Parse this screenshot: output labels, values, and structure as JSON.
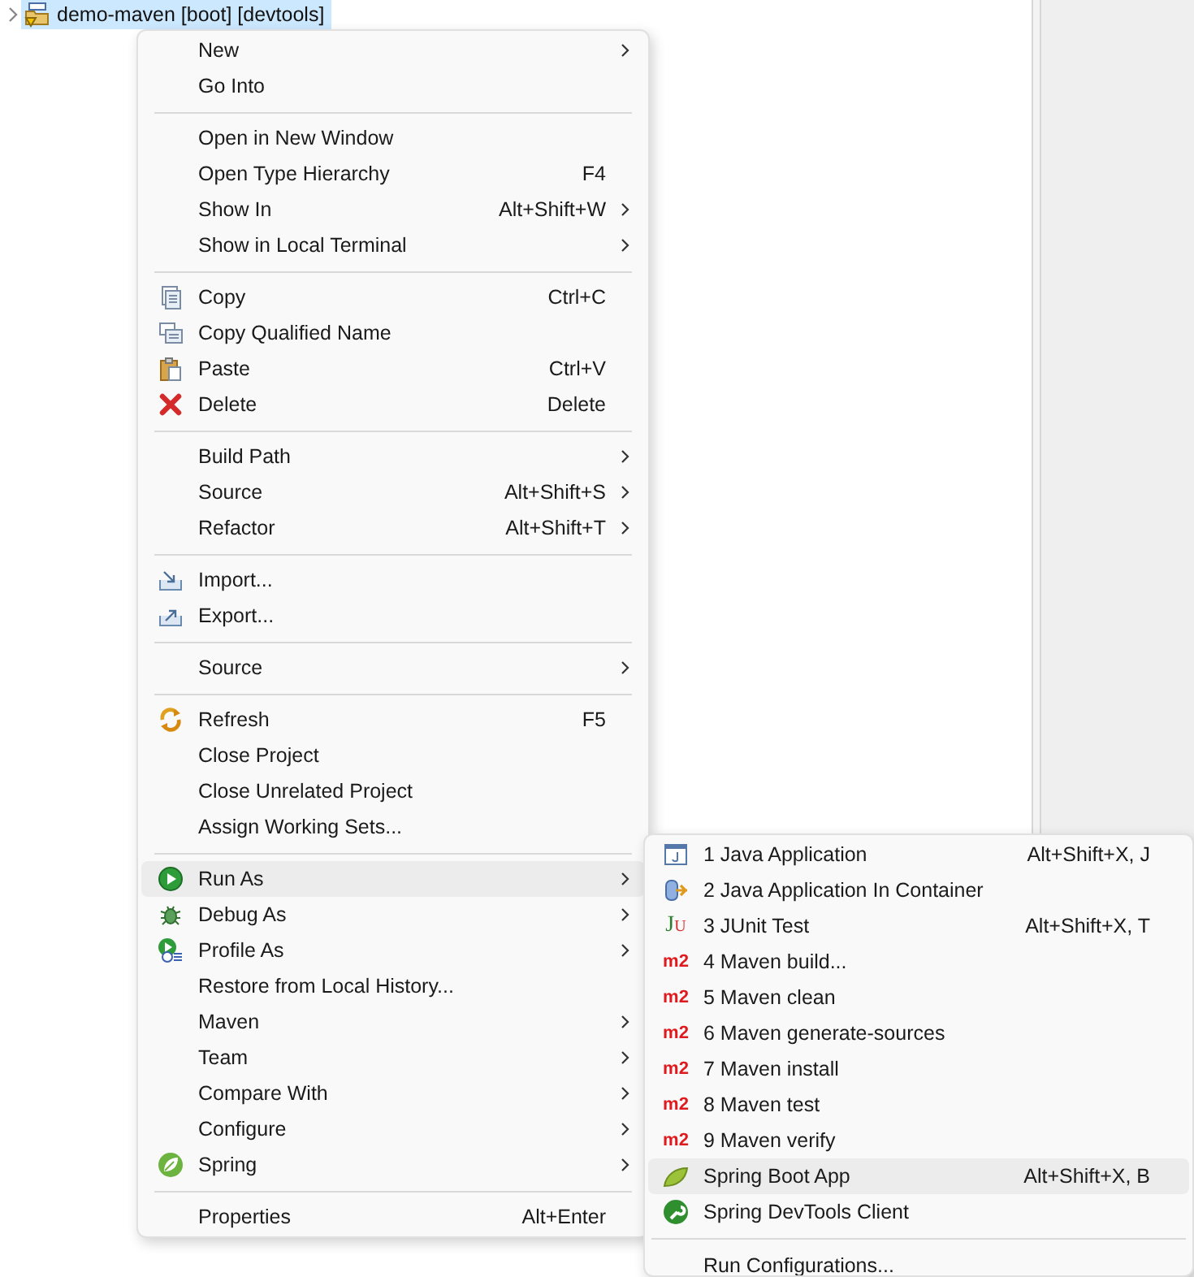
{
  "tree": {
    "label": "demo-maven [boot] [devtools]",
    "selected": true
  },
  "context_menu": {
    "items": [
      {
        "kind": "item",
        "label": "New",
        "submenu": true,
        "selected": false
      },
      {
        "kind": "item",
        "label": "Go Into",
        "selected": false
      },
      {
        "kind": "separator"
      },
      {
        "kind": "item",
        "label": "Open in New Window",
        "selected": false
      },
      {
        "kind": "item",
        "label": "Open Type Hierarchy",
        "shortcut": "F4",
        "selected": false
      },
      {
        "kind": "item",
        "label": "Show In",
        "shortcut": "Alt+Shift+W",
        "submenu": true,
        "selected": false
      },
      {
        "kind": "item",
        "label": "Show in Local Terminal",
        "submenu": true,
        "selected": false
      },
      {
        "kind": "separator"
      },
      {
        "kind": "item",
        "label": "Copy",
        "shortcut": "Ctrl+C",
        "selected": false
      },
      {
        "kind": "item",
        "label": "Copy Qualified Name",
        "selected": false
      },
      {
        "kind": "item",
        "label": "Paste",
        "shortcut": "Ctrl+V",
        "selected": false
      },
      {
        "kind": "item",
        "label": "Delete",
        "shortcut": "Delete",
        "selected": false
      },
      {
        "kind": "separator"
      },
      {
        "kind": "item",
        "label": "Build Path",
        "submenu": true,
        "selected": false
      },
      {
        "kind": "item",
        "label": "Source",
        "shortcut": "Alt+Shift+S",
        "submenu": true,
        "selected": false
      },
      {
        "kind": "item",
        "label": "Refactor",
        "shortcut": "Alt+Shift+T",
        "submenu": true,
        "selected": false
      },
      {
        "kind": "separator"
      },
      {
        "kind": "item",
        "label": "Import...",
        "selected": false
      },
      {
        "kind": "item",
        "label": "Export...",
        "selected": false
      },
      {
        "kind": "separator"
      },
      {
        "kind": "item",
        "label": "Source",
        "submenu": true,
        "selected": false
      },
      {
        "kind": "separator"
      },
      {
        "kind": "item",
        "label": "Refresh",
        "shortcut": "F5",
        "selected": false
      },
      {
        "kind": "item",
        "label": "Close Project",
        "selected": false
      },
      {
        "kind": "item",
        "label": "Close Unrelated Project",
        "selected": false
      },
      {
        "kind": "item",
        "label": "Assign Working Sets...",
        "selected": false
      },
      {
        "kind": "separator"
      },
      {
        "kind": "item",
        "label": "Run As",
        "submenu": true,
        "selected": true
      },
      {
        "kind": "item",
        "label": "Debug As",
        "submenu": true,
        "selected": false
      },
      {
        "kind": "item",
        "label": "Profile As",
        "submenu": true,
        "selected": false
      },
      {
        "kind": "item",
        "label": "Restore from Local History...",
        "selected": false
      },
      {
        "kind": "item",
        "label": "Maven",
        "submenu": true,
        "selected": false
      },
      {
        "kind": "item",
        "label": "Team",
        "submenu": true,
        "selected": false
      },
      {
        "kind": "item",
        "label": "Compare With",
        "submenu": true,
        "selected": false
      },
      {
        "kind": "item",
        "label": "Configure",
        "submenu": true,
        "selected": false
      },
      {
        "kind": "item",
        "label": "Spring",
        "submenu": true,
        "selected": false
      },
      {
        "kind": "separator"
      },
      {
        "kind": "item",
        "label": "Properties",
        "shortcut": "Alt+Enter",
        "selected": false
      }
    ]
  },
  "run_as_submenu": {
    "items": [
      {
        "kind": "item",
        "label": "1 Java Application",
        "shortcut": "Alt+Shift+X, J",
        "selected": false
      },
      {
        "kind": "item",
        "label": "2 Java Application In Container",
        "selected": false
      },
      {
        "kind": "item",
        "badge": "JU",
        "label": "3 JUnit Test",
        "shortcut": "Alt+Shift+X, T",
        "selected": false
      },
      {
        "kind": "item",
        "badge": "m2",
        "label": "4 Maven build...",
        "selected": false
      },
      {
        "kind": "item",
        "badge": "m2",
        "label": "5 Maven clean",
        "selected": false
      },
      {
        "kind": "item",
        "badge": "m2",
        "label": "6 Maven generate-sources",
        "selected": false
      },
      {
        "kind": "item",
        "badge": "m2",
        "label": "7 Maven install",
        "selected": false
      },
      {
        "kind": "item",
        "badge": "m2",
        "label": "8 Maven test",
        "selected": false
      },
      {
        "kind": "item",
        "badge": "m2",
        "label": "9 Maven verify",
        "selected": false
      },
      {
        "kind": "item",
        "label": "Spring Boot App",
        "shortcut": "Alt+Shift+X, B",
        "selected": true
      },
      {
        "kind": "item",
        "label": "Spring DevTools Client",
        "selected": false
      },
      {
        "kind": "separator"
      },
      {
        "kind": "item",
        "label": "Run Configurations...",
        "selected": false
      }
    ]
  }
}
